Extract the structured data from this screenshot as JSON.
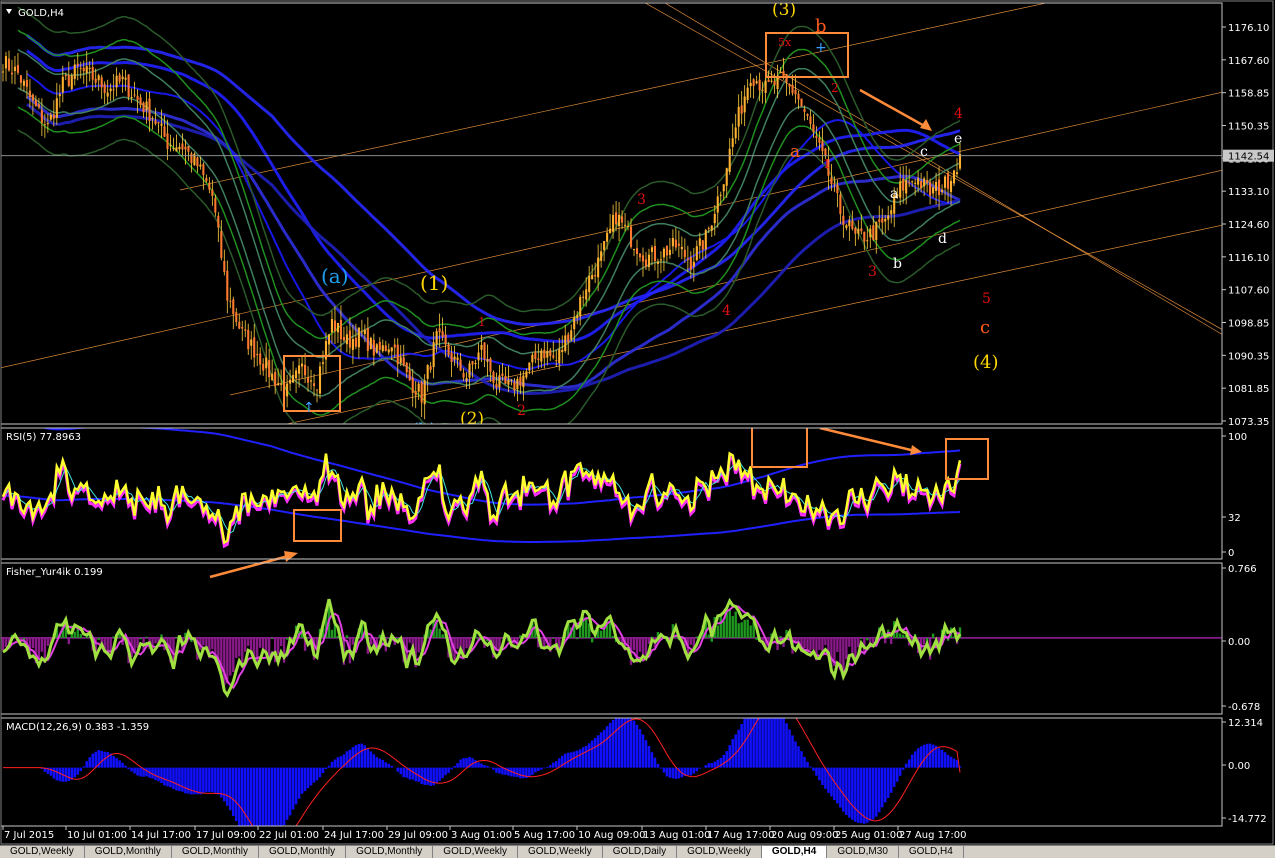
{
  "window": {
    "symbol_title": "GOLD,H4"
  },
  "main": {
    "current_price": "1142.54",
    "price_axis": [
      "1176.10",
      "1167.60",
      "1158.85",
      "1150.35",
      "1141.60",
      "1133.10",
      "1124.60",
      "1116.10",
      "1107.60",
      "1098.85",
      "1090.35",
      "1081.85",
      "1073.35"
    ],
    "wave_labels": [
      {
        "text": "(3)",
        "color": "#ffd700"
      },
      {
        "text": "b",
        "color": "#ff5a1e"
      },
      {
        "text": "5x",
        "color": "#e01010"
      },
      {
        "text": "2",
        "color": "#e01010"
      },
      {
        "text": "4",
        "color": "#e01010"
      },
      {
        "text": "e",
        "color": "#ffffff"
      },
      {
        "text": "c",
        "color": "#ffffff"
      },
      {
        "text": "a",
        "color": "#ff5a1e"
      },
      {
        "text": "1",
        "color": "#e01010"
      },
      {
        "text": "a",
        "color": "#ffffff"
      },
      {
        "text": "3",
        "color": "#e01010"
      },
      {
        "text": "d",
        "color": "#ffffff"
      },
      {
        "text": "3",
        "color": "#e01010"
      },
      {
        "text": "b",
        "color": "#ffffff"
      },
      {
        "text": "(a)",
        "color": "#1ea0f0"
      },
      {
        "text": "(1)",
        "color": "#ffd700"
      },
      {
        "text": "1",
        "color": "#e01010"
      },
      {
        "text": "4",
        "color": "#e01010"
      },
      {
        "text": "5",
        "color": "#e01010"
      },
      {
        "text": "c",
        "color": "#ff5a1e"
      },
      {
        "text": "(4)",
        "color": "#ffd700"
      },
      {
        "text": "(2)",
        "color": "#ffd700"
      },
      {
        "text": "2",
        "color": "#e01010"
      },
      {
        "text": "(b)",
        "color": "#1ea0f0"
      }
    ]
  },
  "rsi": {
    "title": "RSI(5) 77.8963",
    "axis": [
      "100",
      "32",
      "0"
    ]
  },
  "fisher": {
    "title": "Fisher_Yur4ik 0.199",
    "axis": [
      "0.766",
      "0.00",
      "-0.678"
    ]
  },
  "macd": {
    "title": "MACD(12,26,9) 0.383 -1.359",
    "axis": [
      "12.314",
      "0.00",
      "-14.772"
    ]
  },
  "time_axis": [
    "7 Jul 2015",
    "10 Jul 01:00",
    "14 Jul 17:00",
    "17 Jul 09:00",
    "22 Jul 01:00",
    "24 Jul 17:00",
    "29 Jul 09:00",
    "3 Aug 01:00",
    "5 Aug 17:00",
    "10 Aug 09:00",
    "13 Aug 01:00",
    "17 Aug 17:00",
    "20 Aug 09:00",
    "25 Aug 01:00",
    "27 Aug 17:00"
  ],
  "tabs": [
    "GOLD,Weekly",
    "GOLD,Monthly",
    "GOLD,Monthly",
    "GOLD,Monthly",
    "GOLD,Monthly",
    "GOLD,Weekly",
    "GOLD,Weekly",
    "GOLD,Daily",
    "GOLD,Weekly",
    "GOLD,H4",
    "GOLD,M30",
    "GOLD,H4"
  ],
  "active_tab": 9,
  "chart_data": {
    "type": "candlestick",
    "symbol": "GOLD",
    "timeframe": "H4",
    "close_path": [
      [
        0,
        1167
      ],
      [
        5,
        1164
      ],
      [
        10,
        1156
      ],
      [
        15,
        1150
      ],
      [
        20,
        1161
      ],
      [
        25,
        1165
      ],
      [
        30,
        1163
      ],
      [
        35,
        1160
      ],
      [
        40,
        1162
      ],
      [
        45,
        1157
      ],
      [
        50,
        1153
      ],
      [
        55,
        1146
      ],
      [
        60,
        1145
      ],
      [
        65,
        1140
      ],
      [
        70,
        1132
      ],
      [
        75,
        1106
      ],
      [
        80,
        1096
      ],
      [
        85,
        1091
      ],
      [
        90,
        1085
      ],
      [
        95,
        1081
      ],
      [
        100,
        1087
      ],
      [
        105,
        1084
      ],
      [
        110,
        1099
      ],
      [
        115,
        1094
      ],
      [
        120,
        1096
      ],
      [
        125,
        1091
      ],
      [
        130,
        1094
      ],
      [
        135,
        1085
      ],
      [
        140,
        1080
      ],
      [
        145,
        1095
      ],
      [
        150,
        1090
      ],
      [
        155,
        1085
      ],
      [
        160,
        1092
      ],
      [
        165,
        1083
      ],
      [
        170,
        1082
      ],
      [
        175,
        1086
      ],
      [
        180,
        1092
      ],
      [
        185,
        1089
      ],
      [
        190,
        1098
      ],
      [
        195,
        1109
      ],
      [
        200,
        1116
      ],
      [
        205,
        1127
      ],
      [
        210,
        1121
      ],
      [
        215,
        1116
      ],
      [
        220,
        1117
      ],
      [
        225,
        1119
      ],
      [
        230,
        1115
      ],
      [
        235,
        1121
      ],
      [
        240,
        1134
      ],
      [
        245,
        1150
      ],
      [
        250,
        1164
      ],
      [
        255,
        1160
      ],
      [
        260,
        1162
      ],
      [
        265,
        1159
      ],
      [
        270,
        1150
      ],
      [
        275,
        1140
      ],
      [
        280,
        1128
      ],
      [
        285,
        1121
      ],
      [
        290,
        1122
      ],
      [
        295,
        1125
      ],
      [
        300,
        1134
      ],
      [
        305,
        1137
      ],
      [
        310,
        1133
      ],
      [
        315,
        1135
      ],
      [
        320,
        1142
      ]
    ],
    "bar_count": 320,
    "rsi_period": 5,
    "rsi_last": 77.8963,
    "rsi_levels": [
      100,
      32,
      0
    ],
    "fisher_last": 0.199,
    "fisher_range": [
      -0.678,
      0.766
    ],
    "macd_params": [
      12,
      26,
      9
    ],
    "macd_main": 0.383,
    "macd_signal": -1.359,
    "macd_range": [
      -14.772,
      12.314
    ]
  }
}
